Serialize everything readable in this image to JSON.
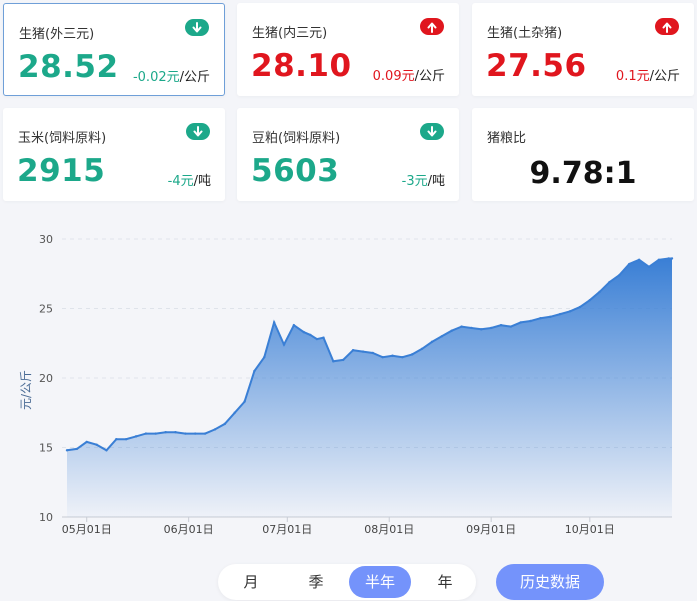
{
  "cards": [
    {
      "title": "生猪(外三元)",
      "value": "28.52",
      "change": "-0.02元",
      "unit": "/公斤",
      "direction": "down"
    },
    {
      "title": "生猪(内三元)",
      "value": "28.10",
      "change": "0.09元",
      "unit": "/公斤",
      "direction": "up"
    },
    {
      "title": "生猪(土杂猪)",
      "value": "27.56",
      "change": "0.1元",
      "unit": "/公斤",
      "direction": "up"
    },
    {
      "title": "玉米(饲料原料)",
      "value": "2915",
      "change": "-4元",
      "unit": "/吨",
      "direction": "down"
    },
    {
      "title": "豆粕(饲料原料)",
      "value": "5603",
      "change": "-3元",
      "unit": "/吨",
      "direction": "down"
    },
    {
      "title": "猪粮比",
      "value": "9.78:1"
    }
  ],
  "icons": {
    "down": "arrow-down-icon",
    "up": "arrow-up-icon"
  },
  "colors": {
    "down": "#1ca88a",
    "up": "#e0161e",
    "accent": "#7493fb",
    "line": "#3a7fd5"
  },
  "tabs": [
    "月",
    "季",
    "半年",
    "年"
  ],
  "active_tab": "半年",
  "history_button": "历史数据",
  "chart_data": {
    "type": "area",
    "ylabel": "元/公斤",
    "ylim": [
      10,
      30
    ],
    "yticks": [
      10,
      15,
      20,
      25,
      30
    ],
    "xticks": [
      "05月01日",
      "06月01日",
      "07月01日",
      "08月01日",
      "09月01日",
      "10月01日"
    ],
    "grid": true,
    "x": [
      "04-25",
      "04-28",
      "05-01",
      "05-04",
      "05-07",
      "05-10",
      "05-13",
      "05-16",
      "05-19",
      "05-22",
      "05-25",
      "05-28",
      "05-31",
      "06-03",
      "06-06",
      "06-09",
      "06-12",
      "06-15",
      "06-18",
      "06-21",
      "06-24",
      "06-27",
      "06-30",
      "07-03",
      "07-06",
      "07-08",
      "07-10",
      "07-12",
      "07-15",
      "07-18",
      "07-21",
      "07-24",
      "07-27",
      "07-30",
      "08-02",
      "08-05",
      "08-08",
      "08-11",
      "08-14",
      "08-17",
      "08-20",
      "08-23",
      "08-26",
      "08-29",
      "09-01",
      "09-04",
      "09-07",
      "09-10",
      "09-13",
      "09-16",
      "09-19",
      "09-22",
      "09-25",
      "09-28",
      "10-01",
      "10-04",
      "10-07",
      "10-10",
      "10-13",
      "10-16",
      "10-19",
      "10-22",
      "10-25",
      "10-26"
    ],
    "values": [
      14.8,
      14.9,
      15.4,
      15.2,
      14.8,
      15.6,
      15.6,
      15.8,
      16.0,
      16.0,
      16.1,
      16.1,
      16.0,
      16.0,
      16.0,
      16.3,
      16.7,
      17.5,
      18.3,
      20.5,
      21.5,
      24.0,
      22.4,
      23.8,
      23.3,
      23.1,
      22.8,
      22.9,
      21.2,
      21.3,
      22.0,
      21.9,
      21.8,
      21.5,
      21.6,
      21.5,
      21.7,
      22.1,
      22.6,
      23.0,
      23.4,
      23.7,
      23.6,
      23.5,
      23.6,
      23.8,
      23.7,
      24.0,
      24.1,
      24.3,
      24.4,
      24.6,
      24.8,
      25.1,
      25.6,
      26.2,
      26.9,
      27.4,
      28.2,
      28.5,
      28.0,
      28.5,
      28.6,
      28.6
    ]
  }
}
